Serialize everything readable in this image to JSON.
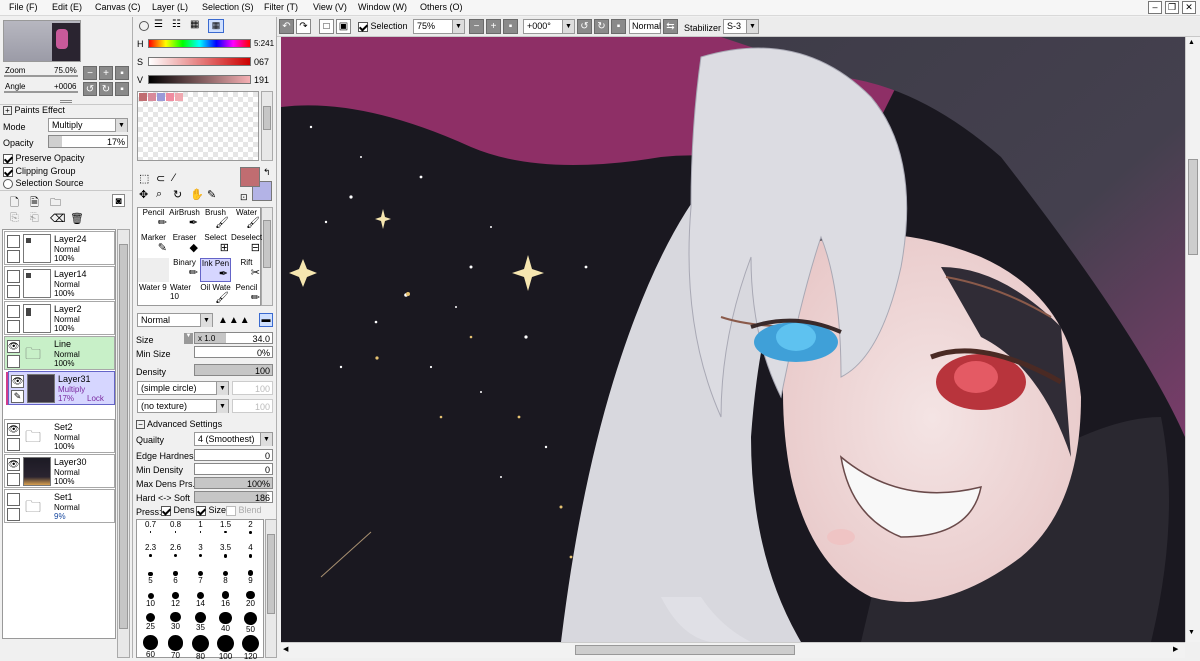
{
  "menu": [
    "File (F)",
    "Edit (E)",
    "Canvas (C)",
    "Layer (L)",
    "Selection (S)",
    "Filter (T)",
    "View (V)",
    "Window (W)",
    "Others (O)"
  ],
  "toolbar": {
    "selection_label": "Selection",
    "zoom": "75%",
    "angle": "+000°",
    "blend": "Normal",
    "stabilizer_label": "Stabilizer",
    "stabilizer": "S-3"
  },
  "navigator": {
    "zoom_label": "Zoom",
    "zoom_value": "75.0%",
    "angle_label": "Angle",
    "angle_value": "+0006"
  },
  "paints_effect": {
    "header": "Paints Effect",
    "mode_label": "Mode",
    "mode_value": "Multiply",
    "opacity_label": "Opacity",
    "opacity_value": "17%",
    "opacity_fraction": 0.17,
    "preserve_opacity": "Preserve Opacity",
    "clipping_group": "Clipping Group",
    "selection_source": "Selection Source"
  },
  "layers": [
    {
      "name": "Layer24",
      "mode": "Normal",
      "opacity": "100%"
    },
    {
      "name": "Layer14",
      "mode": "Normal",
      "opacity": "100%"
    },
    {
      "name": "Layer2",
      "mode": "Normal",
      "opacity": "100%"
    },
    {
      "name": "Line",
      "mode": "Normal",
      "opacity": "100%"
    },
    {
      "name": "Layer31",
      "mode": "Multiply",
      "opacity": "17%",
      "lock": "Lock"
    },
    {
      "name": "Set2",
      "mode": "Normal",
      "opacity": "100%"
    },
    {
      "name": "Layer30",
      "mode": "Normal",
      "opacity": "100%"
    },
    {
      "name": "Set1",
      "mode": "Normal",
      "opacity": "9%"
    }
  ],
  "color": {
    "h_label": "H",
    "h_value": "5:241",
    "s_label": "S",
    "s_value": "067",
    "v_label": "V",
    "v_value": "191",
    "primary": "#c06d71",
    "secondary": "#b3b3e6"
  },
  "tools": [
    {
      "label": "Pencil"
    },
    {
      "label": "AirBrush"
    },
    {
      "label": "Brush"
    },
    {
      "label": "Water"
    },
    {
      "label": "Marker"
    },
    {
      "label": "Eraser"
    },
    {
      "label": "Select"
    },
    {
      "label": "Deselect"
    },
    {
      "label": ""
    },
    {
      "label": "Binary"
    },
    {
      "label": "Ink Pen"
    },
    {
      "label": "Rift"
    },
    {
      "label": "Water 9"
    },
    {
      "label": "Water 10"
    },
    {
      "label": "Oil Wate"
    },
    {
      "label": "Pencil"
    }
  ],
  "brush": {
    "blend": "Normal",
    "size_label": "Size",
    "size_mult": "x 1.0",
    "size_value": "34.0",
    "minsize_label": "Min Size",
    "minsize_value": "0%",
    "density_label": "Density",
    "density_value": "100",
    "shape": "(simple circle)",
    "shape_val": "100",
    "texture": "(no texture)",
    "texture_val": "100",
    "advanced": "Advanced Settings",
    "quality_label": "Quailty",
    "quality_value": "4 (Smoothest)",
    "edge_label": "Edge Hardness",
    "edge_value": "0",
    "mindens_label": "Min Density",
    "mindens_value": "0",
    "maxdens_label": "Max Dens Prs.",
    "maxdens_value": "100%",
    "hardsoft_label": "Hard <-> Soft",
    "hardsoft_value": "186",
    "press_label": "Press:",
    "press_dens": "Dens",
    "press_size": "Size",
    "press_blend": "Blend"
  },
  "sizes": [
    "0.7",
    "0.8",
    "1",
    "1.5",
    "2",
    "2.3",
    "2.6",
    "3",
    "3.5",
    "4",
    "5",
    "6",
    "7",
    "8",
    "9",
    "10",
    "12",
    "14",
    "16",
    "20",
    "25",
    "30",
    "35",
    "40",
    "50",
    "60",
    "70",
    "80",
    "100",
    "120"
  ]
}
